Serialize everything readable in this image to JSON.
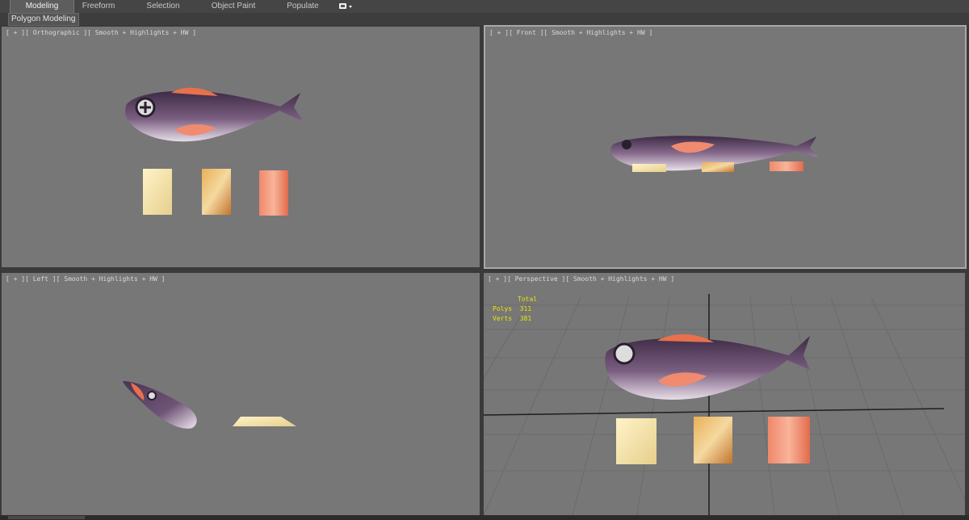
{
  "ribbon": {
    "tabs": [
      {
        "label": "Modeling",
        "active": true
      },
      {
        "label": "Freeform",
        "active": false
      },
      {
        "label": "Selection",
        "active": false
      },
      {
        "label": "Object Paint",
        "active": false
      },
      {
        "label": "Populate",
        "active": false
      }
    ],
    "extra_icon": "ribbon-options-icon",
    "panel_label": "Polygon Modeling"
  },
  "viewports": {
    "top_left": {
      "label": "[ + ][ Orthographic ][ Smooth + Highlights + HW ]"
    },
    "top_right": {
      "label": "[ + ][ Front ][ Smooth + Highlights + HW ]"
    },
    "bottom_left": {
      "label": "[ + ][ Left ][ Smooth + Highlights + HW ]"
    },
    "bottom_right": {
      "label": "[ + ][ Perspective ][ Smooth + Highlights + HW ]",
      "stats": {
        "header": "Total",
        "polys_label": "Polys",
        "polys": "311",
        "verts_label": "Verts",
        "verts": "381"
      }
    }
  },
  "colors": {
    "viewport_bg": "#777777",
    "fish_body": "#5a3d5f",
    "fish_fin": "#e86a4a",
    "stats_text": "#e6e600"
  }
}
